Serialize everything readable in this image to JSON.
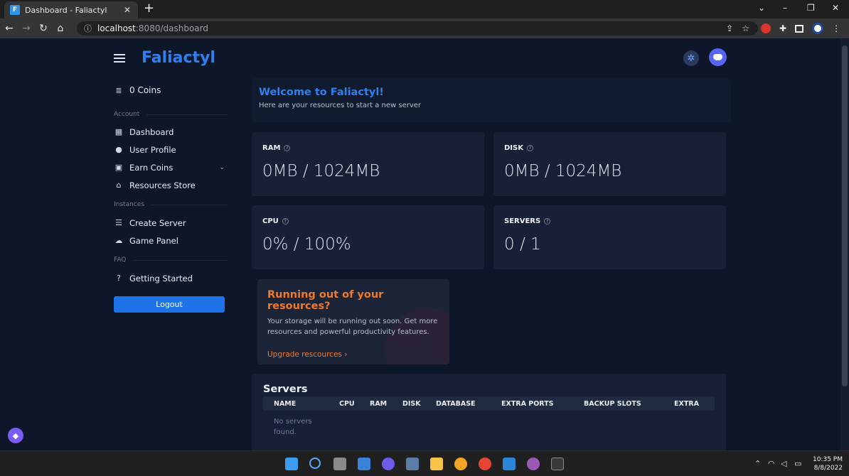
{
  "browser": {
    "tab_title": "Dashboard - Faliactyl",
    "favicon_letter": "F",
    "url_host": "localhost",
    "url_rest": ":8080/dashboard"
  },
  "app": {
    "brand": "Faliactyl",
    "coins": "0 Coins",
    "sections": {
      "account": "Account",
      "instances": "Instances",
      "faq": "FAQ"
    },
    "nav": {
      "dashboard": "Dashboard",
      "user_profile": "User Profile",
      "earn_coins": "Earn Coins",
      "resources_store": "Resources Store",
      "create_server": "Create Server",
      "game_panel": "Game Panel",
      "getting_started": "Getting Started"
    },
    "logout": "Logout"
  },
  "welcome": {
    "title": "Welcome to Faliactyl!",
    "subtitle": "Here are your resources to start a new server"
  },
  "resources": {
    "ram": {
      "label": "RAM",
      "value": "0MB / 1024MB"
    },
    "disk": {
      "label": "DISK",
      "value": "0MB / 1024MB"
    },
    "cpu": {
      "label": "CPU",
      "value": "0% / 100%"
    },
    "servers": {
      "label": "SERVERS",
      "value": "0 / 1"
    }
  },
  "upgrade": {
    "title": "Running out of your resources?",
    "text": "Your storage will be running out soon. Get more resources and powerful productivity features.",
    "link": "Upgrade rescources ›"
  },
  "servers_table": {
    "title": "Servers",
    "columns": [
      "NAME",
      "CPU",
      "RAM",
      "DISK",
      "DATABASE",
      "EXTRA PORTS",
      "BACKUP SLOTS",
      "EXTRA"
    ],
    "empty": "No servers found."
  },
  "taskbar": {
    "time": "10:35 PM",
    "date": "8/8/2022"
  },
  "colors": {
    "accent": "#2f80ed",
    "warning": "#f07a2c",
    "background": "#0e1629",
    "card": "#172036"
  }
}
